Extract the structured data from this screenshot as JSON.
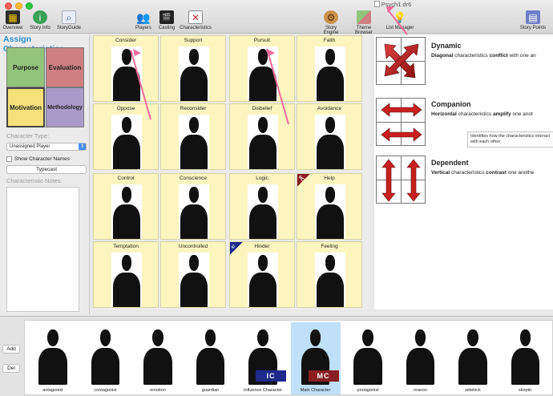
{
  "window": {
    "title": "Psych1.dr6"
  },
  "toolbar": {
    "overview": "Overview",
    "story_info": "Story Info",
    "storyguide": "StoryGuide",
    "players": "Players",
    "casting": "Casting",
    "characteristics": "Characteristics",
    "story_engine": "Story Engine",
    "theme_browser": "Theme Browser",
    "list_manager": "List Manager",
    "story_points": "Story Points"
  },
  "left_panel": {
    "title": "Assign Characteristics",
    "quads": {
      "purpose": "Purpose",
      "evaluation": "Evaluation",
      "motivation": "Motivation",
      "methodology": "Methodology"
    },
    "character_type_label": "Character Type:",
    "character_type_value": "Unassigned Player",
    "show_names_label": "Show Character Names",
    "typecast_button": "Typecast",
    "notes_label": "Characteristic Notes:"
  },
  "grid": {
    "cells": [
      {
        "label": "Consider"
      },
      {
        "label": "Support"
      },
      {
        "label": "Pursuit"
      },
      {
        "label": "Faith"
      },
      {
        "label": "Oppose"
      },
      {
        "label": "Reconsider"
      },
      {
        "label": "Disbelief"
      },
      {
        "label": "Avoidance"
      },
      {
        "label": "Control"
      },
      {
        "label": "Conscience"
      },
      {
        "label": "Logic"
      },
      {
        "label": "Help"
      },
      {
        "label": "Temptation"
      },
      {
        "label": "Uncontrolled"
      },
      {
        "label": "Hinder"
      },
      {
        "label": "Feeling"
      }
    ],
    "mc_badge": "MC",
    "ic_badge": "IC"
  },
  "relations": {
    "dynamic": {
      "title": "Dynamic",
      "desc_b1": "Diagonal",
      "desc_t1": " characteristics ",
      "desc_b2": "conflict",
      "desc_t2": " with one an"
    },
    "companion": {
      "title": "Companion",
      "desc_b1": "Horizontal",
      "desc_t1": " characteristics ",
      "desc_b2": "amplify",
      "desc_t2": " one anot"
    },
    "dependent": {
      "title": "Dependent",
      "desc_b1": "Vertical",
      "desc_t1": " characteristics ",
      "desc_b2": "contrast",
      "desc_t2": " one anothe"
    },
    "tooltip": "Identifies how the characteristics interact with each other"
  },
  "bottom": {
    "add_button": "Add",
    "del_button": "Del",
    "players": [
      {
        "name": "antagonist"
      },
      {
        "name": "contagonist"
      },
      {
        "name": "emotion"
      },
      {
        "name": "guardian"
      },
      {
        "name": "Influence Character",
        "badge": "IC"
      },
      {
        "name": "Main Character",
        "badge": "MC"
      },
      {
        "name": "protagonist"
      },
      {
        "name": "reason"
      },
      {
        "name": "sidekick"
      },
      {
        "name": "skeptic"
      }
    ]
  },
  "colors": {
    "accent_blue": "#2f8fd0",
    "purpose": "#92c47b",
    "evaluation": "#cf7f82",
    "motivation": "#f6e07a",
    "methodology": "#a89ac9",
    "cell_bg": "#fdf5bf",
    "mc_badge": "#8a1d22",
    "ic_badge": "#1d2a8a",
    "annotation_arrow": "#f06a9b"
  }
}
